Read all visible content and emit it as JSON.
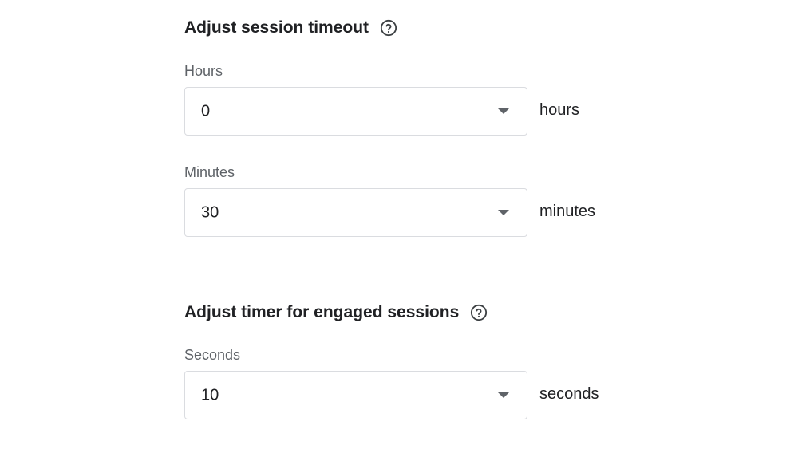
{
  "session_timeout": {
    "title": "Adjust session timeout",
    "help_icon": "help-circle-icon",
    "hours": {
      "label": "Hours",
      "value": "0",
      "unit": "hours"
    },
    "minutes": {
      "label": "Minutes",
      "value": "30",
      "unit": "minutes"
    }
  },
  "engaged_sessions": {
    "title": "Adjust timer for engaged sessions",
    "help_icon": "help-circle-icon",
    "seconds": {
      "label": "Seconds",
      "value": "10",
      "unit": "seconds"
    }
  },
  "colors": {
    "text_primary": "#202124",
    "text_secondary": "#5f6368",
    "border": "#dadce0"
  }
}
